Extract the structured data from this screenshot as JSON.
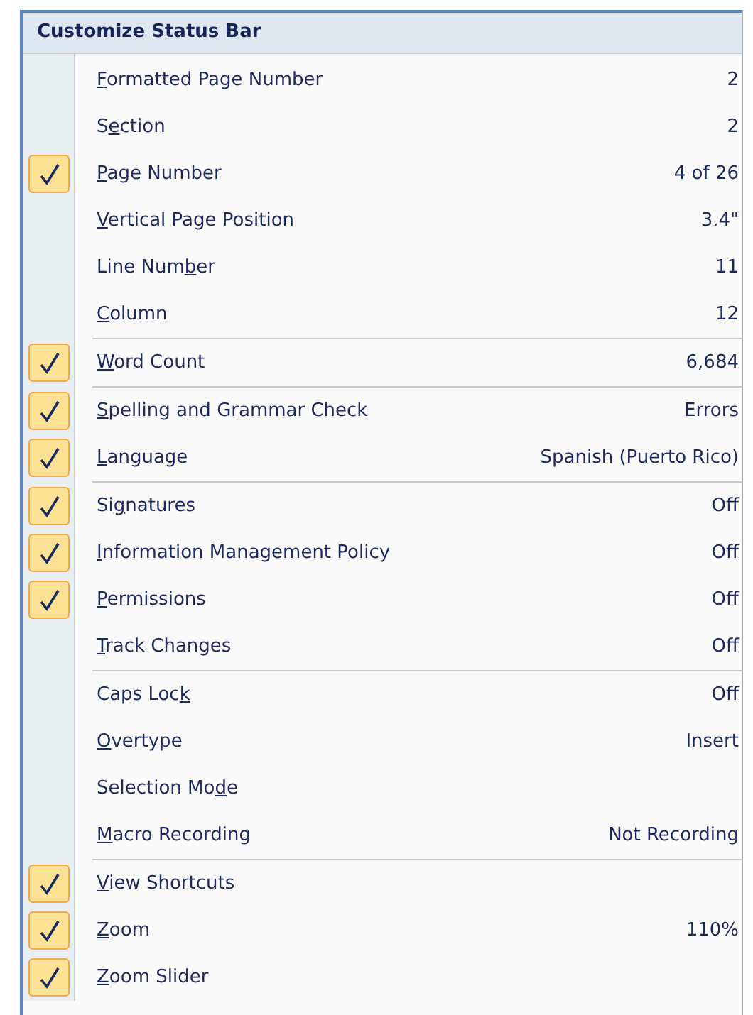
{
  "menu": {
    "title": "Customize Status Bar",
    "groups": [
      {
        "items": [
          {
            "label": {
              "key": "F",
              "after": "ormatted Page Number"
            },
            "value": "2",
            "checked": false
          },
          {
            "label": {
              "before": "S",
              "key": "e",
              "after": "ction"
            },
            "value": "2",
            "checked": false
          },
          {
            "label": {
              "key": "P",
              "after": "age Number"
            },
            "value": "4 of 26",
            "checked": true
          },
          {
            "label": {
              "key": "V",
              "after": "ertical Page Position"
            },
            "value": "3.4\"",
            "checked": false
          },
          {
            "label": {
              "before": "Line Num",
              "key": "b",
              "after": "er"
            },
            "value": "11",
            "checked": false
          },
          {
            "label": {
              "key": "C",
              "after": "olumn"
            },
            "value": "12",
            "checked": false
          }
        ]
      },
      {
        "items": [
          {
            "label": {
              "key": "W",
              "after": "ord Count"
            },
            "value": "6,684",
            "checked": true
          }
        ]
      },
      {
        "items": [
          {
            "label": {
              "key": "S",
              "after": "pelling and Grammar Check"
            },
            "value": "Errors",
            "checked": true
          },
          {
            "label": {
              "key": "L",
              "after": "anguage"
            },
            "value": "Spanish (Puerto Rico)",
            "checked": true
          }
        ]
      },
      {
        "items": [
          {
            "label": {
              "before": "Si",
              "key": "g",
              "after": "natures"
            },
            "value": "Off",
            "checked": true
          },
          {
            "label": {
              "key": "I",
              "after": "nformation Management Policy"
            },
            "value": "Off",
            "checked": true
          },
          {
            "label": {
              "key": "P",
              "after": "ermissions"
            },
            "value": "Off",
            "checked": true
          },
          {
            "label": {
              "key": "T",
              "after": "rack Changes"
            },
            "value": "Off",
            "checked": false
          }
        ]
      },
      {
        "items": [
          {
            "label": {
              "before": "Caps Loc",
              "key": "k"
            },
            "value": "Off",
            "checked": false
          },
          {
            "label": {
              "key": "O",
              "after": "vertype"
            },
            "value": "Insert",
            "checked": false
          },
          {
            "label": {
              "before": "Selection Mo",
              "key": "d",
              "after": "e"
            },
            "checked": false
          },
          {
            "label": {
              "key": "M",
              "after": "acro Recording"
            },
            "value": "Not Recording",
            "checked": false
          }
        ]
      },
      {
        "items": [
          {
            "label": {
              "key": "V",
              "after": "iew Shortcuts"
            },
            "checked": true
          },
          {
            "label": {
              "key": "Z",
              "after": "oom"
            },
            "value": "110%",
            "checked": true
          },
          {
            "label": {
              "key": "Z",
              "after": "oom Slider"
            },
            "checked": true
          }
        ]
      }
    ]
  }
}
